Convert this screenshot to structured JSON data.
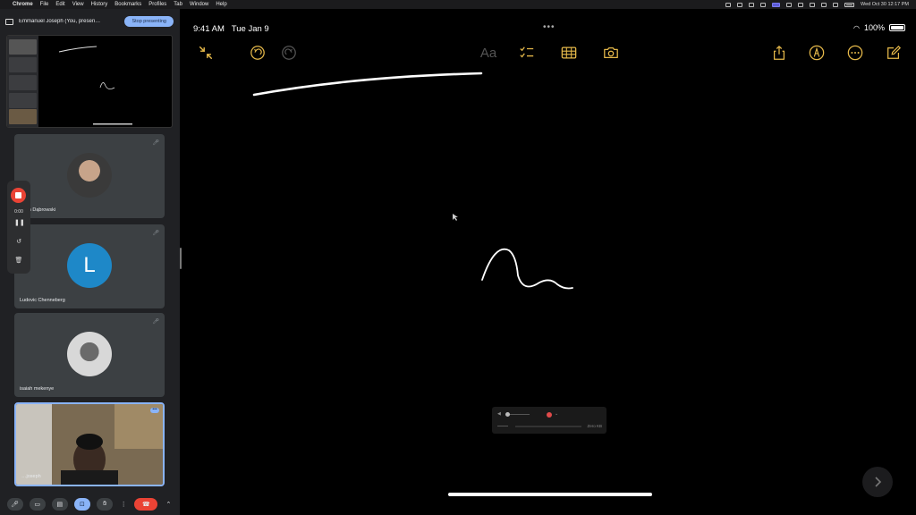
{
  "menubar": {
    "apple_glyph": "",
    "items": [
      "Chrome",
      "File",
      "Edit",
      "View",
      "History",
      "Bookmarks",
      "Profiles",
      "Tab",
      "Window",
      "Help"
    ],
    "datetime": "Wed Oct 30  12:17 PM"
  },
  "meet": {
    "presenting_label": "Emmanuel Joseph (You, presen…",
    "stop_presenting": "Stop presenting",
    "recording_time": "0:00",
    "participants": [
      {
        "name": "…lan Dąbrowski",
        "kind": "photo"
      },
      {
        "name": "Ludovic Chenneberg",
        "kind": "letter",
        "letter": "L"
      },
      {
        "name": "isaiah mekenye",
        "kind": "photo"
      },
      {
        "name": "…joseph",
        "kind": "self"
      }
    ],
    "self_more": "•••"
  },
  "ipad": {
    "time": "9:41 AM",
    "date": "Tue Jan 9",
    "battery": "100%",
    "toolbar_text_style": "Aa",
    "recorder_size": "Zero KB"
  },
  "colors": {
    "accent_yellow": "#e6b94a",
    "meet_blue": "#8ab4f8",
    "hangup_red": "#ea4335"
  }
}
